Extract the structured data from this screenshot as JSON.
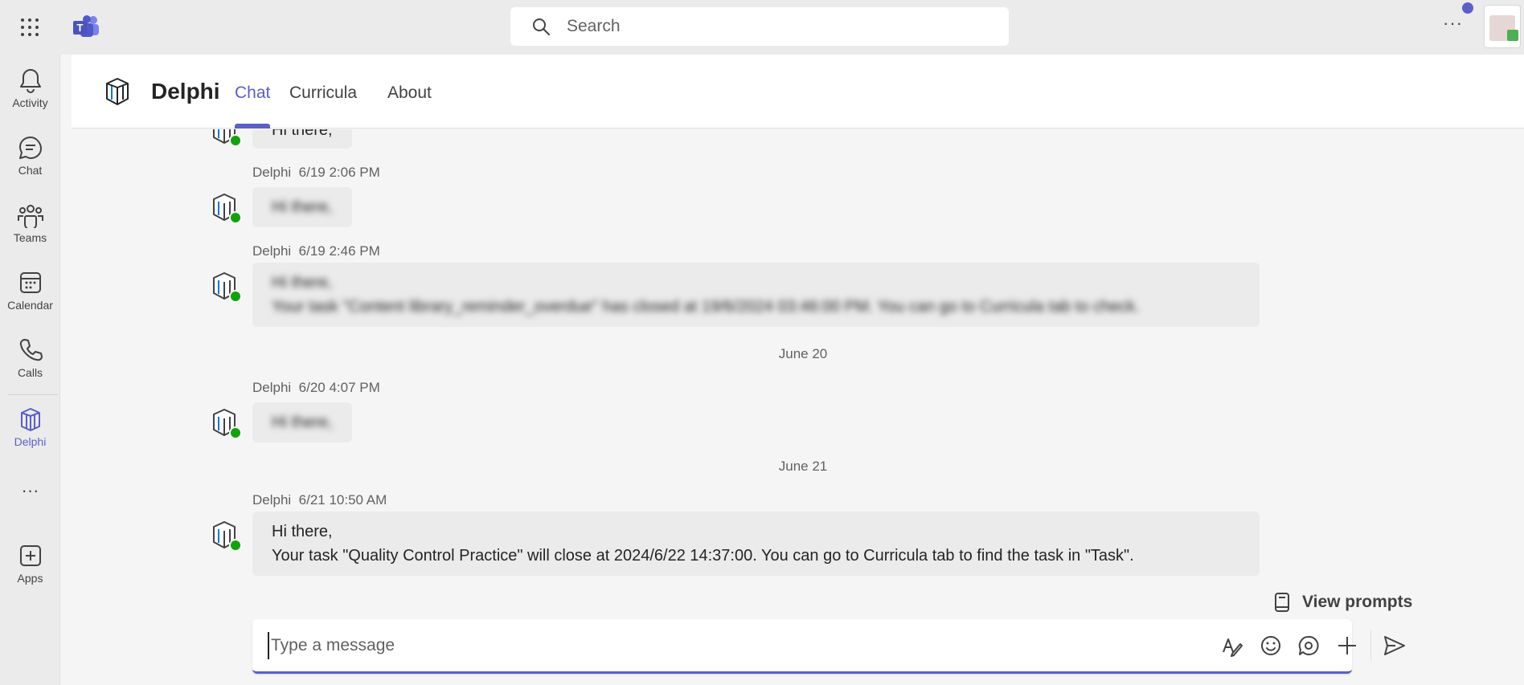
{
  "topbar": {
    "search_placeholder": "Search",
    "more_label": "···"
  },
  "rail": {
    "items": [
      {
        "label": "Activity",
        "icon": "bell-icon"
      },
      {
        "label": "Chat",
        "icon": "chat-icon"
      },
      {
        "label": "Teams",
        "icon": "teams-icon"
      },
      {
        "label": "Calendar",
        "icon": "calendar-icon"
      },
      {
        "label": "Calls",
        "icon": "phone-icon"
      },
      {
        "label": "Delphi",
        "icon": "delphi-icon",
        "active": true
      },
      {
        "label": "···",
        "icon": "more-icon"
      },
      {
        "label": "Apps",
        "icon": "add-app-icon"
      }
    ]
  },
  "header": {
    "title": "Delphi",
    "tabs": [
      "Chat",
      "Curricula",
      "About"
    ],
    "active_tab": "Chat"
  },
  "messages": [
    {
      "sender": "",
      "time": "",
      "lines": [
        "Hi there,"
      ],
      "partial": true
    },
    {
      "sender": "Delphi",
      "time": "6/19 2:06 PM",
      "lines": [
        "Hi there,"
      ],
      "blurred": true
    },
    {
      "sender": "Delphi",
      "time": "6/19 2:46 PM",
      "lines": [
        "Hi there,",
        "Your task \"Content library_reminder_overdue\" has closed at 19/6/2024 03:46:00 PM. You can go to Curricula tab to check."
      ],
      "blurred": true
    },
    {
      "sender": "Delphi",
      "time": "6/20 4:07 PM",
      "lines": [
        "Hi there,"
      ],
      "blurred": true
    },
    {
      "sender": "Delphi",
      "time": "6/21 10:50 AM",
      "lines": [
        "Hi there,",
        "Your task \"Quality Control Practice\" will close at 2024/6/22 14:37:00. You can go to Curricula tab to find the task in \"Task\"."
      ],
      "blurred": false
    }
  ],
  "date_separators": [
    "June 20",
    "June 21"
  ],
  "compose": {
    "view_prompts": "View prompts",
    "placeholder": "Type a message"
  },
  "colors": {
    "accent": "#5b5fc7",
    "presence": "#13a10e",
    "bubble": "#ebebeb"
  }
}
